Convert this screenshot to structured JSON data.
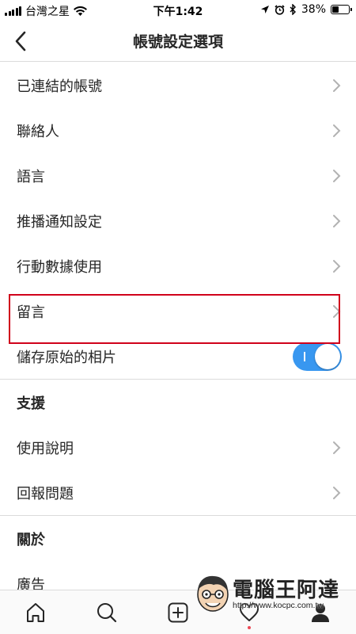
{
  "status_bar": {
    "carrier": "台灣之星",
    "time": "下午1:42",
    "battery": "38%",
    "battery_level": 0.38
  },
  "header": {
    "title": "帳號設定選項",
    "back_icon": "chevron-left-icon"
  },
  "rows": [
    {
      "label": "已連結的帳號"
    },
    {
      "label": "聯絡人"
    },
    {
      "label": "語言"
    },
    {
      "label": "推播通知設定"
    },
    {
      "label": "行動數據使用"
    },
    {
      "label": "留言"
    },
    {
      "label": "儲存原始的相片",
      "toggle_on": true
    }
  ],
  "support": {
    "title": "支援",
    "items": [
      {
        "label": "使用說明"
      },
      {
        "label": "回報問題"
      }
    ]
  },
  "about": {
    "title": "關於",
    "partial_item": "廣告"
  },
  "colors": {
    "accent": "#3897f0",
    "highlight": "#d0021b",
    "notification_dot": "#ed4956"
  },
  "tabbar": {
    "tabs": [
      "home-icon",
      "search-icon",
      "add-icon",
      "heart-icon",
      "profile-icon"
    ]
  },
  "watermark": {
    "name": "電腦王阿達",
    "url": "http://www.kocpc.com.tw"
  }
}
